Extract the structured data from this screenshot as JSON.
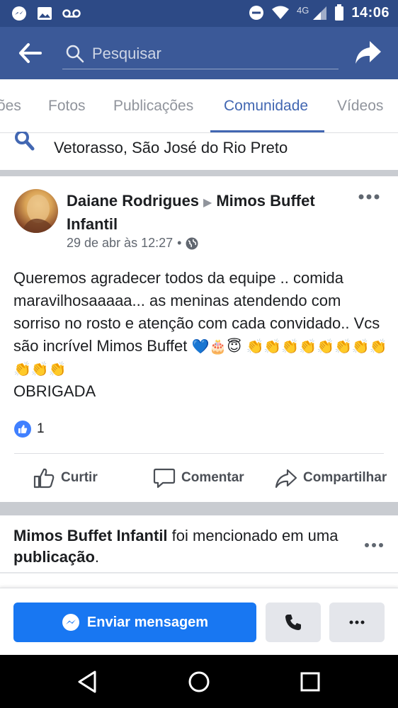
{
  "status_bar": {
    "time": "14:06",
    "network": "4G"
  },
  "search": {
    "placeholder": "Pesquisar"
  },
  "tabs": [
    {
      "label": "ões"
    },
    {
      "label": "Fotos"
    },
    {
      "label": "Publicações"
    },
    {
      "label": "Comunidade"
    },
    {
      "label": "Vídeos"
    }
  ],
  "active_tab": "Comunidade",
  "location": {
    "text": "Vetorasso, São José do Rio Preto"
  },
  "post": {
    "author": "Daiane Rodrigues",
    "page": "Mimos Buffet Infantil",
    "timestamp": "29 de abr às 12:27",
    "meta_separator": "•",
    "body_line1": "Queremos agradecer todos da equipe .. comida maravilhosaaaaa... as meninas atendendo com sorriso no rosto e atenção com cada convidado.. Vcs são incrível Mimos Buffet",
    "emojis": "💙🎂😇 👏👏👏👏👏👏👏👏👏👏👏",
    "body_line2": "OBRIGADA",
    "reaction_count": "1",
    "actions": {
      "like": "Curtir",
      "comment": "Comentar",
      "share": "Compartilhar"
    }
  },
  "mention": {
    "page": "Mimos Buffet Infantil",
    "middle": " foi mencionado em uma ",
    "link": "publicação",
    "end": "."
  },
  "bottom_bar": {
    "send_label": "Enviar mensagem"
  },
  "colors": {
    "app_bar": "#3b5998",
    "accent": "#4267b2",
    "primary_button": "#1877f2"
  }
}
